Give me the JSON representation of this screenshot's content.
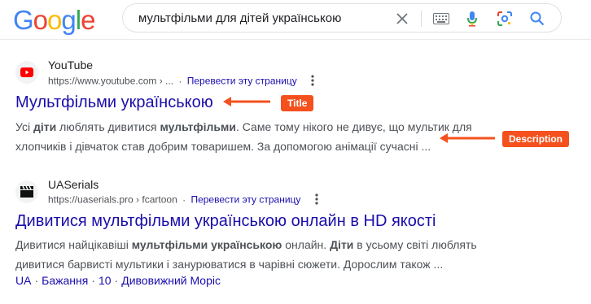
{
  "search": {
    "logo": [
      "G",
      "o",
      "o",
      "g",
      "l",
      "e"
    ],
    "logo_colors": [
      "#4285F4",
      "#EA4335",
      "#FBBC05",
      "#4285F4",
      "#34A853",
      "#EA4335"
    ],
    "query": "мультфільми для дітей українською"
  },
  "results": [
    {
      "site_name": "YouTube",
      "url": "https://www.youtube.com › ...",
      "translate": "Перевести эту страницу",
      "title": "Мультфільми українською",
      "desc_line1": [
        "Усі ",
        "діти",
        " люблять дивитися ",
        "мультфільми",
        ". Саме тому нікого не дивує, що мультик для"
      ],
      "desc_line2": "хлопчиків і дівчаток став добрим товаришем. За допомогою анімації сучасні ..."
    },
    {
      "site_name": "UASerials",
      "url": "https://uaserials.pro › fcartoon",
      "translate": "Перевести эту страницу",
      "title": "Дивитися мультфільми українською онлайн в HD якості",
      "desc_line1": [
        "Дивитися найцікавіші ",
        "мультфільми українською",
        " онлайн. ",
        "Діти",
        " в усьому світі люблять"
      ],
      "desc_line2": "дивитися барвисті мультики і занурюватися в чарівні сюжети. Дорослим також ...",
      "sitelinks": [
        "UA",
        "Бажання",
        "10",
        "Дивовижний Моріс"
      ]
    }
  ],
  "annotations": {
    "title_label": "Title",
    "description_label": "Description",
    "color": "#f4511e"
  }
}
